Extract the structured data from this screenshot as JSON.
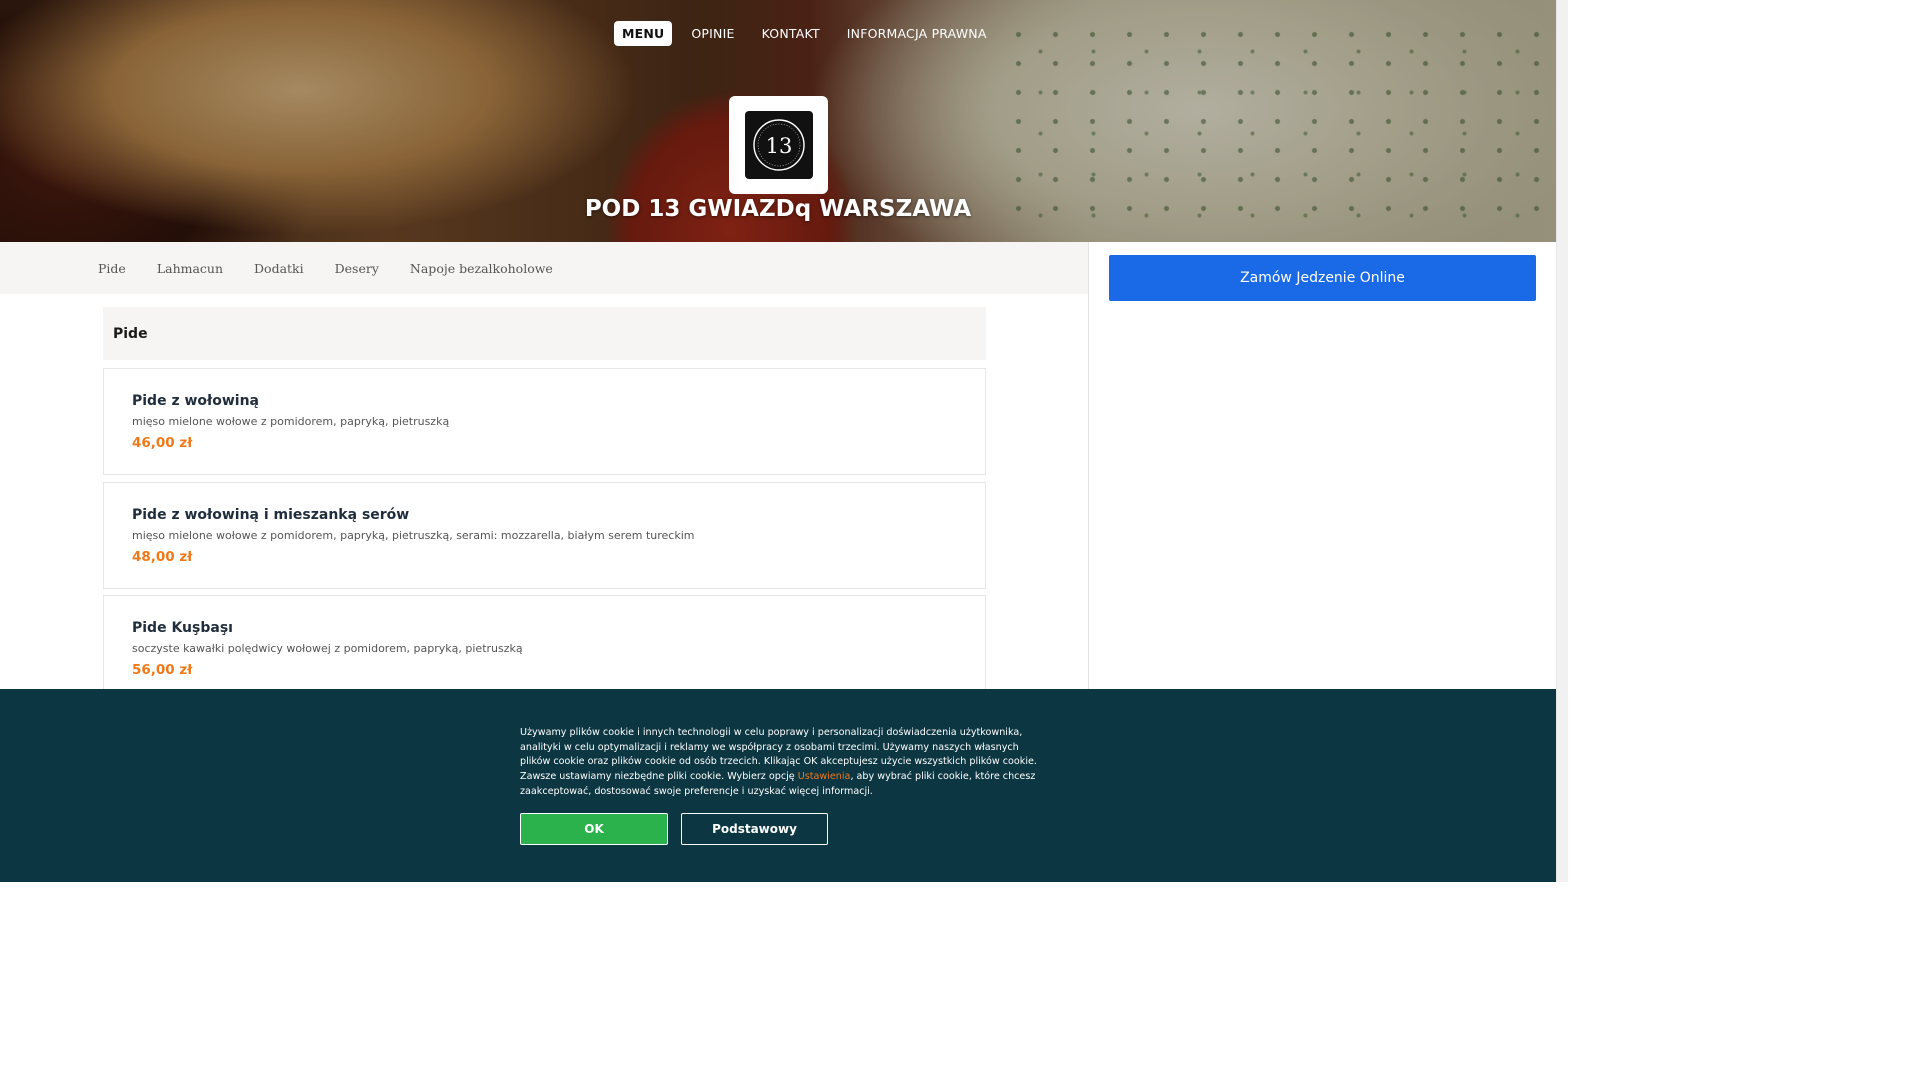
{
  "topnav": {
    "items": [
      "MENU",
      "OPINIE",
      "KONTAKT",
      "INFORMACJA PRAWNA"
    ]
  },
  "hero": {
    "logo_text": "13",
    "title": "POD 13 GWIAZDq WARSZAWA"
  },
  "categories": [
    "Pide",
    "Lahmacun",
    "Dodatki",
    "Desery",
    "Napoje bezalkoholowe"
  ],
  "order_button": "Zamów Jedzenie Online",
  "menu": {
    "section_title": "Pide",
    "items": [
      {
        "name": "Pide z wołowiną",
        "description": "mięso mielone wołowe z pomidorem, papryką, pietruszką",
        "price": "46,00 zł"
      },
      {
        "name": "Pide z wołowiną i mieszanką serów",
        "description": "mięso mielone wołowe z pomidorem, papryką, pietruszką, serami: mozzarella, białym serem tureckim",
        "price": "48,00 zł"
      },
      {
        "name": "Pide Kuşbaşı",
        "description": "soczyste kawałki polędwicy wołowej z pomidorem, papryką, pietruszką",
        "price": "56,00 zł"
      }
    ]
  },
  "cookie": {
    "text_before": "Używamy plików cookie i innych technologii w celu poprawy i personalizacji doświadczenia użytkownika, analityki w celu optymalizacji i reklamy we współpracy z osobami trzecimi. Używamy naszych własnych plików cookie oraz plików cookie od osób trzecich. Klikając OK akceptujesz użycie wszystkich plików cookie. Zawsze ustawiamy niezbędne pliki cookie. Wybierz opcję ",
    "link": "Ustawienia",
    "text_after": ", aby wybrać pliki cookie, które chcesz zaakceptować, dostosować swoje preferencje i uzyskać więcej informacji.",
    "ok_label": "OK",
    "basic_label": "Podstawowy"
  },
  "colors": {
    "accent_orange": "#f07a1a",
    "primary_blue": "#1a6ae8",
    "cookie_bg": "#0c3641",
    "ok_green": "#2bb24c"
  }
}
